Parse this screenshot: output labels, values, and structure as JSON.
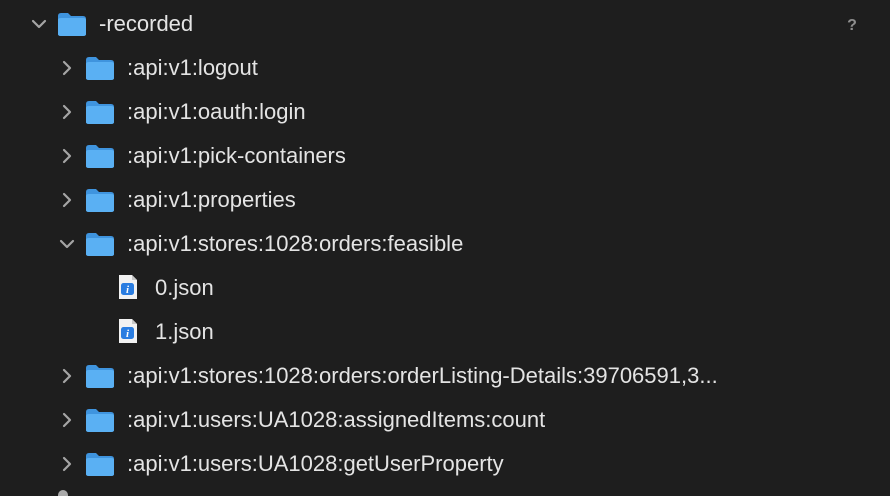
{
  "tree": {
    "root": {
      "label": "-recorded",
      "expanded": true
    },
    "items": [
      {
        "label": ":api:v1:logout",
        "kind": "folder",
        "expanded": false
      },
      {
        "label": ":api:v1:oauth:login",
        "kind": "folder",
        "expanded": false
      },
      {
        "label": ":api:v1:pick-containers",
        "kind": "folder",
        "expanded": false
      },
      {
        "label": ":api:v1:properties",
        "kind": "folder",
        "expanded": false
      },
      {
        "label": ":api:v1:stores:1028:orders:feasible",
        "kind": "folder",
        "expanded": true
      },
      {
        "label": "0.json",
        "kind": "file"
      },
      {
        "label": "1.json",
        "kind": "file"
      },
      {
        "label": ":api:v1:stores:1028:orders:orderListing-Details:39706591,3...",
        "kind": "folder",
        "expanded": false
      },
      {
        "label": ":api:v1:users:UA1028:assignedItems:count",
        "kind": "folder",
        "expanded": false
      },
      {
        "label": ":api:v1:users:UA1028:getUserProperty",
        "kind": "folder",
        "expanded": false
      }
    ]
  },
  "help": {
    "symbol": "?"
  },
  "colors": {
    "background": "#1e1e1e",
    "text": "#e4e4e4",
    "chevron": "#a5a5a5",
    "folder": "#5ab0f3",
    "file_badge": "#2a7de1"
  }
}
